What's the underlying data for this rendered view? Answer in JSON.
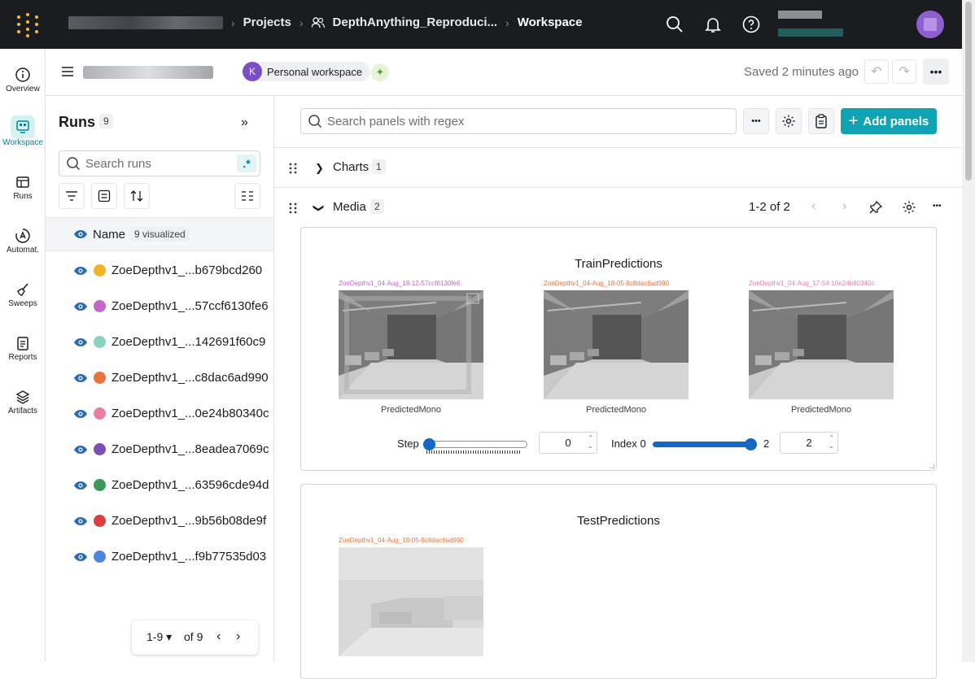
{
  "topbar": {
    "breadcrumbs": [
      "Projects",
      "DepthAnything_Reproduci...",
      "Workspace"
    ]
  },
  "leftnav": {
    "items": [
      {
        "label": "Overview",
        "icon": "info-icon"
      },
      {
        "label": "Workspace",
        "icon": "workspace-icon",
        "active": true
      },
      {
        "label": "Runs",
        "icon": "table-icon"
      },
      {
        "label": "Automat.",
        "icon": "automations-icon"
      },
      {
        "label": "Sweeps",
        "icon": "broom-icon"
      },
      {
        "label": "Reports",
        "icon": "report-icon"
      },
      {
        "label": "Artifacts",
        "icon": "layers-icon"
      }
    ]
  },
  "header": {
    "workspace_avatar": "K",
    "workspace_label": "Personal workspace",
    "saved_text": "Saved 2 minutes ago"
  },
  "runs_panel": {
    "title": "Runs",
    "count": "9",
    "search_placeholder": "Search runs",
    "regex_label": ".*",
    "column_name": "Name",
    "visualized_badge": "9 visualized",
    "rows": [
      {
        "name": "ZoeDepthv1_...b679bcd260",
        "color": "#f0b429"
      },
      {
        "name": "ZoeDepthv1_...57ccf6130fe6",
        "color": "#c467c9"
      },
      {
        "name": "ZoeDepthv1_...142691f60c9",
        "color": "#87d3c0"
      },
      {
        "name": "ZoeDepthv1_...c8dac6ad990",
        "color": "#e8743b"
      },
      {
        "name": "ZoeDepthv1_...0e24b80340c",
        "color": "#ec7ea6"
      },
      {
        "name": "ZoeDepthv1_...8eadea7069c",
        "color": "#7e4fb4"
      },
      {
        "name": "ZoeDepthv1_...63596cde94d",
        "color": "#3a9a5b"
      },
      {
        "name": "ZoeDepthv1_...9b56b08de9f",
        "color": "#dd3e3e"
      },
      {
        "name": "ZoeDepthv1_...f9b77535d03",
        "color": "#4d86dd"
      }
    ],
    "pager_range": "1-9",
    "pager_of": "of 9"
  },
  "main": {
    "search_placeholder": "Search panels with regex",
    "add_panels_label": "Add panels",
    "sections": [
      {
        "title": "Charts",
        "count": "1",
        "expanded": false
      },
      {
        "title": "Media",
        "count": "2",
        "expanded": true,
        "pagination": "1-2 of 2"
      }
    ],
    "train_panel": {
      "title": "TrainPredictions",
      "images": [
        {
          "caption": "ZoeDepthv1_04-Aug_18-12-57ccf6130fe6",
          "color": "#c467c9",
          "label": "PredictedMono"
        },
        {
          "caption": "ZoeDepthv1_04-Aug_18-05-8c8dac6ad990",
          "color": "#e8743b",
          "label": "PredictedMono"
        },
        {
          "caption": "ZoeDepthv1_04-Aug_17-54-10e24b80340c",
          "color": "#ec7ea6",
          "label": "PredictedMono"
        }
      ],
      "step_label": "Step",
      "step_value": "0",
      "step_fraction": 0,
      "index_label": "Index",
      "index_min": "0",
      "index_max": "2",
      "index_value": "2",
      "index_fraction": 1
    },
    "test_panel": {
      "title": "TestPredictions",
      "images": [
        {
          "caption": "ZoeDepthv1_04-Aug_18-05-8c8dac6ad990",
          "color": "#e8743b"
        }
      ]
    }
  },
  "colors": {
    "accent": "#10a3b3",
    "topbar_bg": "#1a1c1f",
    "active_nav": "#038194"
  }
}
